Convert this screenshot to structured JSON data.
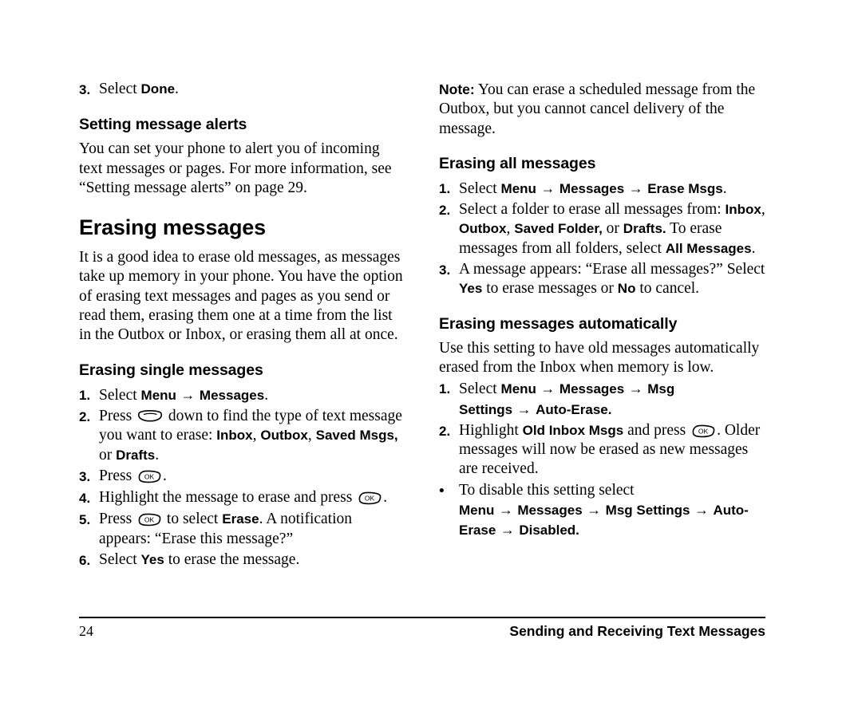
{
  "document": {
    "page_number": "24",
    "chapter": "Sending and Receiving Text Messages"
  },
  "left_column": {
    "step_done": {
      "num": "3.",
      "pre": "Select ",
      "bold": "Done",
      "post": "."
    },
    "heading_alerts": "Setting message alerts",
    "para_alerts": "You can set your phone to alert you of incoming text messages or pages. For more information, see “Setting message alerts” on page 29.",
    "heading_erasing": "Erasing messages",
    "para_erasing": "It is a good idea to erase old messages, as messages take up memory in your phone. You have the option of erasing text messages and pages as you send or read them, erasing them one at a time from the list in the Outbox or Inbox, or erasing them all at once.",
    "heading_single": "Erasing single messages",
    "steps": [
      {
        "num": "1.",
        "parts": [
          {
            "t": "text",
            "v": "Select "
          },
          {
            "t": "bold",
            "v": "Menu"
          },
          {
            "t": "arrow"
          },
          {
            "t": "bold",
            "v": "Messages"
          },
          {
            "t": "text",
            "v": "."
          }
        ]
      },
      {
        "num": "2.",
        "parts": [
          {
            "t": "text",
            "v": "Press "
          },
          {
            "t": "key",
            "v": "nav-key"
          },
          {
            "t": "text",
            "v": " down to find the type of text message you want to erase: "
          },
          {
            "t": "bold",
            "v": "Inbox"
          },
          {
            "t": "text",
            "v": ", "
          },
          {
            "t": "bold",
            "v": "Outbox"
          },
          {
            "t": "text",
            "v": ", "
          },
          {
            "t": "bold",
            "v": "Saved Msgs,"
          },
          {
            "t": "text",
            "v": " or "
          },
          {
            "t": "bold",
            "v": "Drafts"
          },
          {
            "t": "text",
            "v": "."
          }
        ]
      },
      {
        "num": "3.",
        "parts": [
          {
            "t": "text",
            "v": "Press "
          },
          {
            "t": "key",
            "v": "ok-key"
          },
          {
            "t": "text",
            "v": "."
          }
        ]
      },
      {
        "num": "4.",
        "parts": [
          {
            "t": "text",
            "v": "Highlight the message to erase and press "
          },
          {
            "t": "key",
            "v": "ok-key"
          },
          {
            "t": "text",
            "v": "."
          }
        ]
      },
      {
        "num": "5.",
        "parts": [
          {
            "t": "text",
            "v": "Press "
          },
          {
            "t": "key",
            "v": "ok-key"
          },
          {
            "t": "text",
            "v": " to select "
          },
          {
            "t": "bold",
            "v": "Erase"
          },
          {
            "t": "text",
            "v": ". A notification appears: “Erase this message?”"
          }
        ]
      },
      {
        "num": "6.",
        "parts": [
          {
            "t": "text",
            "v": "Select "
          },
          {
            "t": "bold",
            "v": "Yes"
          },
          {
            "t": "text",
            "v": " to erase the message."
          }
        ]
      }
    ]
  },
  "right_column": {
    "note_label": "Note:",
    "note_text": " You can erase a scheduled message from the Outbox, but you cannot cancel delivery of the message.",
    "heading_all": "Erasing all messages",
    "steps_all": [
      {
        "num": "1.",
        "parts": [
          {
            "t": "text",
            "v": "Select "
          },
          {
            "t": "bold",
            "v": "Menu"
          },
          {
            "t": "arrow"
          },
          {
            "t": "bold",
            "v": "Messages"
          },
          {
            "t": "arrow"
          },
          {
            "t": "bold",
            "v": "Erase Msgs"
          },
          {
            "t": "text",
            "v": "."
          }
        ]
      },
      {
        "num": "2.",
        "parts": [
          {
            "t": "text",
            "v": "Select a folder to erase all messages from: "
          },
          {
            "t": "bold",
            "v": "Inbox"
          },
          {
            "t": "text",
            "v": ", "
          },
          {
            "t": "bold",
            "v": "Outbox"
          },
          {
            "t": "text",
            "v": ", "
          },
          {
            "t": "bold",
            "v": "Saved Folder,"
          },
          {
            "t": "text",
            "v": " or "
          },
          {
            "t": "bold",
            "v": "Drafts."
          },
          {
            "t": "text",
            "v": " To erase messages from all folders, select "
          },
          {
            "t": "bold",
            "v": "All Messages"
          },
          {
            "t": "text",
            "v": "."
          }
        ]
      },
      {
        "num": "3.",
        "parts": [
          {
            "t": "text",
            "v": "A message appears: “Erase all messages?” Select "
          },
          {
            "t": "bold",
            "v": "Yes"
          },
          {
            "t": "text",
            "v": " to erase messages or "
          },
          {
            "t": "bold",
            "v": "No"
          },
          {
            "t": "text",
            "v": " to cancel."
          }
        ]
      }
    ],
    "heading_auto": "Erasing messages automatically",
    "para_auto": "Use this setting to have old messages automatically erased from the Inbox when memory is low.",
    "steps_auto": [
      {
        "num": "1.",
        "parts": [
          {
            "t": "text",
            "v": "Select "
          },
          {
            "t": "bold",
            "v": "Menu"
          },
          {
            "t": "arrow"
          },
          {
            "t": "bold",
            "v": "Messages"
          },
          {
            "t": "arrow"
          },
          {
            "t": "bold",
            "v": "Msg Settings"
          },
          {
            "t": "arrow"
          },
          {
            "t": "bold",
            "v": "Auto-Erase."
          }
        ]
      },
      {
        "num": "2.",
        "parts": [
          {
            "t": "text",
            "v": "Highlight "
          },
          {
            "t": "bold",
            "v": "Old Inbox Msgs"
          },
          {
            "t": "text",
            "v": " and press "
          },
          {
            "t": "key",
            "v": "ok-key"
          },
          {
            "t": "text",
            "v": ". Older messages will now be erased as new messages are received."
          }
        ]
      },
      {
        "num": "•",
        "bullet": true,
        "parts": [
          {
            "t": "text",
            "v": "To disable this setting select "
          },
          {
            "t": "bold",
            "v": "Menu"
          },
          {
            "t": "arrow"
          },
          {
            "t": "bold",
            "v": "Messages"
          },
          {
            "t": "arrow"
          },
          {
            "t": "bold",
            "v": "Msg Settings"
          },
          {
            "t": "arrow"
          },
          {
            "t": "bold",
            "v": "Auto-Erase"
          },
          {
            "t": "arrow"
          },
          {
            "t": "bold",
            "v": "Disabled."
          }
        ]
      }
    ]
  }
}
